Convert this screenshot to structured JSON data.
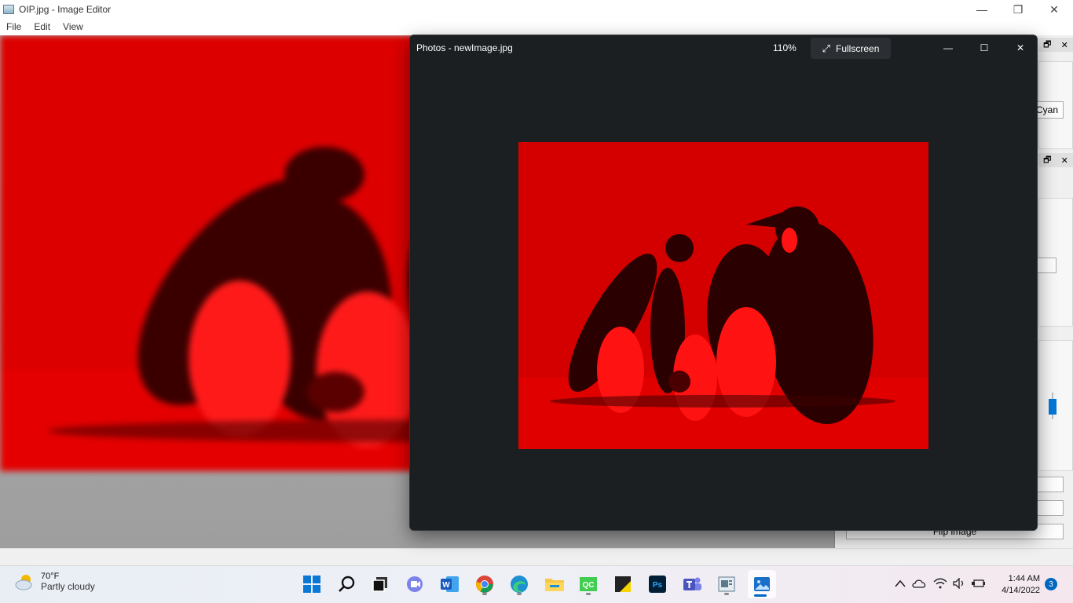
{
  "editor": {
    "title": "OIP.jpg - Image Editor",
    "menu": [
      "File",
      "Edit",
      "View"
    ],
    "caption": {
      "minimize": "—",
      "restore": "❐",
      "close": "✕"
    },
    "dock": {
      "cyan_button": "Cyan",
      "flip_button": "Flip image",
      "float_icon": "🗗",
      "close_icon": "✕"
    }
  },
  "photos": {
    "title": "Photos - newImage.jpg",
    "zoom": "110%",
    "fullscreen_label": "Fullscreen",
    "caption": {
      "minimize": "—",
      "maximize": "☐",
      "close": "✕"
    }
  },
  "taskbar": {
    "weather": {
      "temp": "70°F",
      "desc": "Partly cloudy"
    },
    "apps": [
      "start-icon",
      "search-icon",
      "task-view-icon",
      "teams-chat-icon",
      "word-icon",
      "chrome-icon",
      "edge-icon",
      "file-explorer-icon",
      "qc-icon",
      "sticky-notes-icon",
      "photoshop-icon",
      "teams-icon",
      "image-editor-icon",
      "photos-icon"
    ],
    "apps_labels": {
      "qc": "QC",
      "ps": "Ps",
      "word": "W"
    },
    "clock": {
      "time": "1:44 AM",
      "date": "4/14/2022"
    },
    "notification_count": "3"
  },
  "colors": {
    "image_red": "#e00000",
    "photos_bg": "#1c1f22",
    "accent": "#0067c0"
  }
}
